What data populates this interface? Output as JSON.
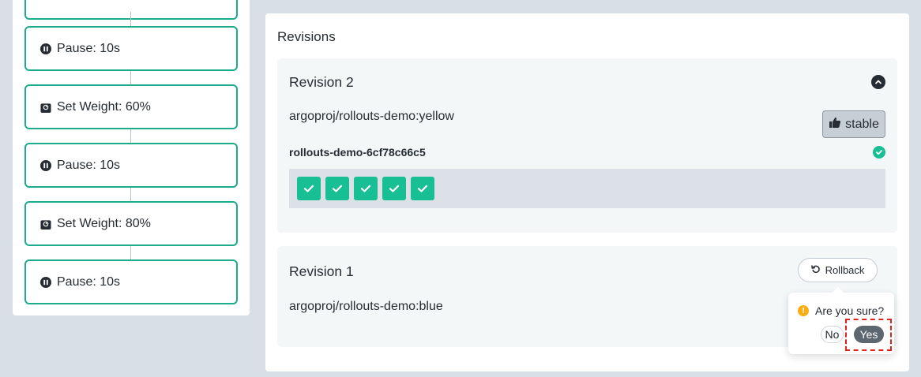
{
  "steps": [
    {
      "label": "",
      "icon": "weight-icon"
    },
    {
      "label": "Pause: 10s",
      "icon": "pause-icon"
    },
    {
      "label": "Set Weight: 60%",
      "icon": "weight-icon"
    },
    {
      "label": "Pause: 10s",
      "icon": "pause-icon"
    },
    {
      "label": "Set Weight: 80%",
      "icon": "weight-icon"
    },
    {
      "label": "Pause: 10s",
      "icon": "pause-icon"
    }
  ],
  "revisions": {
    "title": "Revisions",
    "revision2": {
      "name": "Revision 2",
      "image": "argoproj/rollouts-demo:yellow",
      "badge": "stable",
      "replicaset": "rollouts-demo-6cf78c66c5",
      "pods_count": 5
    },
    "revision1": {
      "name": "Revision 1",
      "image": "argoproj/rollouts-demo:blue",
      "rollback_label": "Rollback"
    }
  },
  "popconfirm": {
    "title": "Are you sure?",
    "no_label": "No",
    "yes_label": "Yes"
  },
  "colors": {
    "accent": "#1dab8d",
    "pod_green": "#18be94",
    "warning": "#faad14",
    "highlight": "#e0231c"
  }
}
